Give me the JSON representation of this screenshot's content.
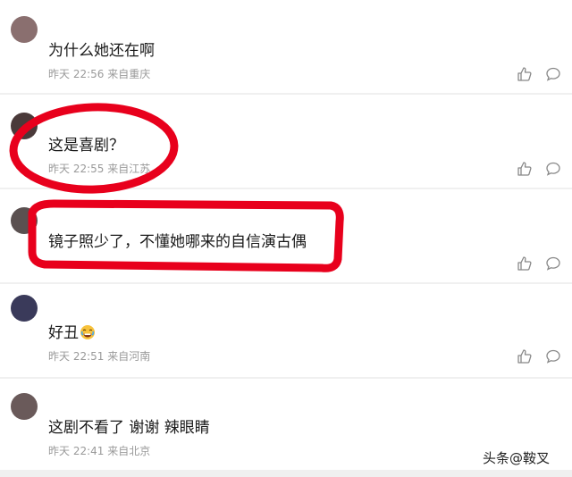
{
  "comments": [
    {
      "text": "为什么她还在啊",
      "time": "昨天 22:56",
      "location": "来自重庆",
      "username": ""
    },
    {
      "text": "这是喜剧？",
      "time": "昨天 22:55",
      "location": "来自江苏",
      "username": ""
    },
    {
      "text": "镜子照少了，不懂她哪来的自信演古偶",
      "time": "",
      "location": "",
      "username": ""
    },
    {
      "text": "好丑",
      "time": "昨天 22:51",
      "location": "来自河南",
      "username": ""
    },
    {
      "text": "这剧不看了 谢谢 辣眼睛",
      "time": "昨天 22:41",
      "location": "来自北京",
      "username": ""
    }
  ],
  "icons": {
    "like": "thumbs-up-icon",
    "reply": "comment-bubble-icon",
    "emoji": "crying-laughing-emoji"
  },
  "colors": {
    "highlight": "#e8001c",
    "background": "#f0f0f0",
    "meta": "#9a9a9a"
  },
  "watermark": "头条@鞍叉"
}
